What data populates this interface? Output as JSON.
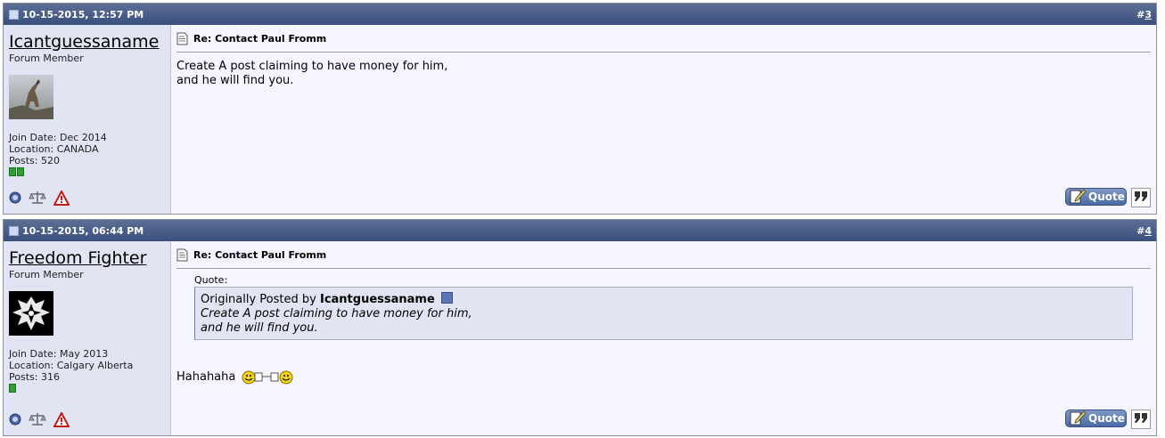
{
  "posts": [
    {
      "date": "10-15-2015, 12:57 PM",
      "number_prefix": "#",
      "number": "3",
      "username": "Icantguessaname",
      "user_title": "Forum Member",
      "join_date": "Join Date: Dec 2014",
      "location": "Location: CANADA",
      "posts_count": "Posts: 520",
      "post_title": "Re: Contact Paul Fromm",
      "message_lines": [
        "Create A post claiming to have money for him,",
        "and he will find you."
      ],
      "quote_button": "Quote"
    },
    {
      "date": "10-15-2015, 06:44 PM",
      "number_prefix": "#",
      "number": "4",
      "username": "Freedom Fighter",
      "user_title": "Forum Member",
      "join_date": "Join Date: May 2013",
      "location": "Location: Calgary Alberta",
      "posts_count": "Posts: 316",
      "post_title": "Re: Contact Paul Fromm",
      "quote_label": "Quote:",
      "quote_prefix": "Originally Posted by",
      "quote_user": "Icantguessaname",
      "quote_lines": [
        "Create A post claiming to have money for him,",
        "and he will find you."
      ],
      "reply_text": "Hahahaha",
      "quote_button": "Quote"
    }
  ],
  "icons": {
    "online_status": "offline-status-icon",
    "scales": "reputation-scales-icon",
    "report": "report-post-icon",
    "post_doc": "post-document-icon",
    "smiley_toast": "cheers-smiley-icon",
    "multiquote": "multiquote-icon"
  },
  "colors": {
    "header_bg": "#3b4f7e",
    "sidebar_bg": "#e1e4f2",
    "body_bg": "#f5f5ff",
    "reputation_green": "#2ea02e"
  }
}
